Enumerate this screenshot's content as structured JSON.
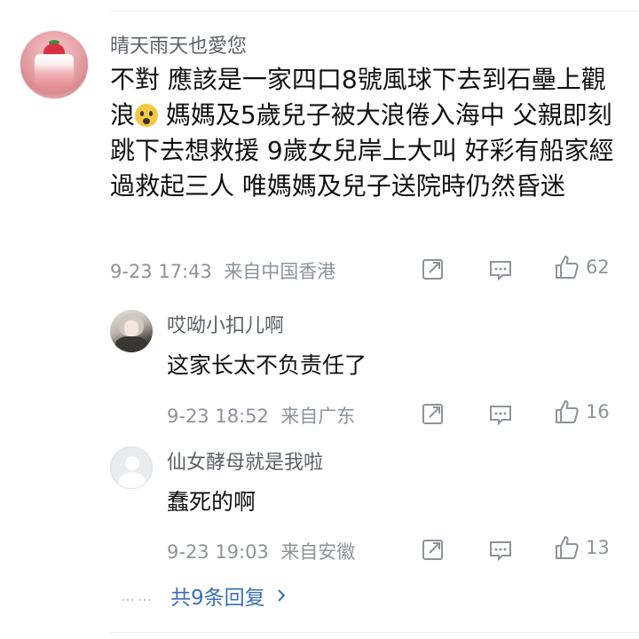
{
  "main_comment": {
    "username": "晴天雨天也愛您",
    "text_before_emoji": "不對 應該是一家四口8號風球下去到石壘上觀浪",
    "emoji": "scream-emoji",
    "text_after_emoji": " 媽媽及5歲兒子被大浪倦入海中 父親即刻跳下去想救援 9歲女兒岸上大叫 好彩有船家經過救起三人 唯媽媽及兒子送院時仍然昏迷",
    "timestamp": "9-23 17:43",
    "location": "来自中国香港",
    "like_count": "62"
  },
  "replies": [
    {
      "username": "哎呦小扣儿啊",
      "text": "这家长太不负责任了",
      "timestamp": "9-23 18:52",
      "location": "来自广东",
      "like_count": "16"
    },
    {
      "username": "仙女酵母就是我啦",
      "text": "蠢死的啊",
      "timestamp": "9-23 19:03",
      "location": "来自安徽",
      "like_count": "13"
    }
  ],
  "more_replies": {
    "dots": "……",
    "label": "共9条回复"
  },
  "colors": {
    "username": "#5c6166",
    "meta": "#8e9399",
    "link": "#3b6fb6"
  }
}
